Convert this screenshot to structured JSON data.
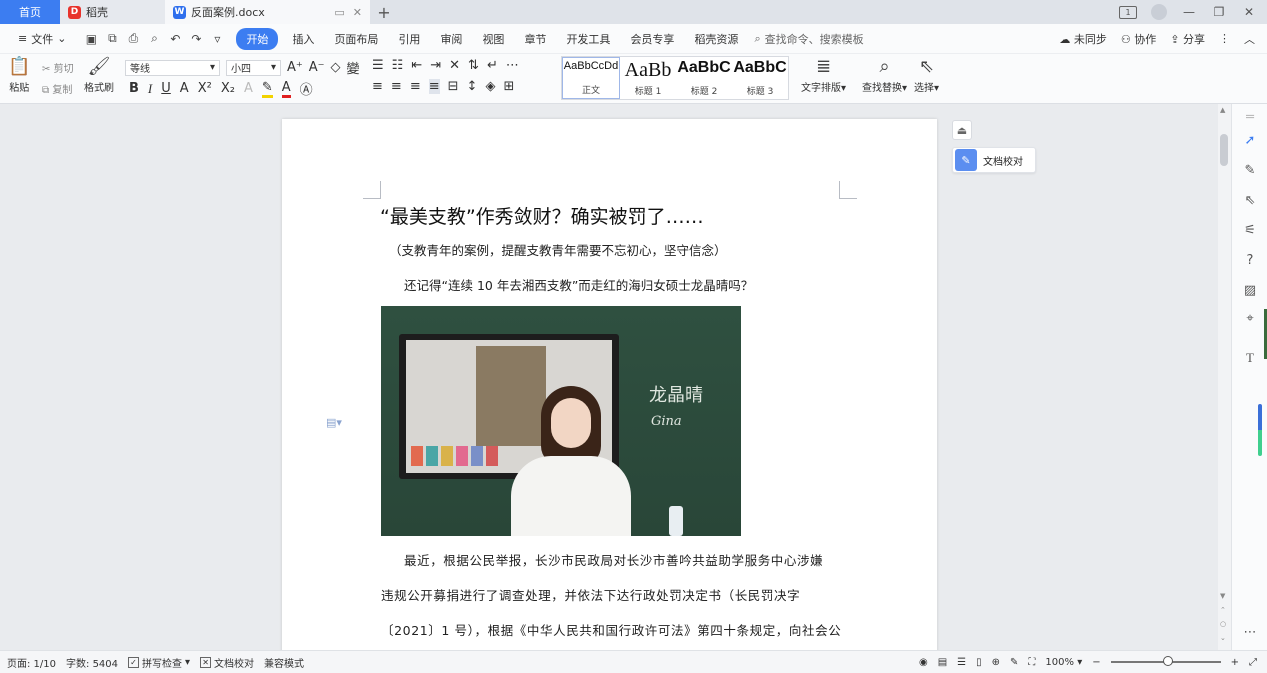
{
  "tabs": {
    "home": "首页",
    "daoke": "稻壳",
    "doc": "反面案例.docx",
    "new_tab": "+"
  },
  "window": {
    "badge": "1"
  },
  "menu": {
    "file": "文件",
    "items": [
      "开始",
      "插入",
      "页面布局",
      "引用",
      "审阅",
      "视图",
      "章节",
      "开发工具",
      "会员专享",
      "稻壳资源"
    ],
    "search": "查找命令、搜索模板",
    "sync": "未同步",
    "collab": "协作",
    "share": "分享"
  },
  "ribbon": {
    "paste": "粘贴",
    "cut": "剪切",
    "copy": "复制",
    "format_painter": "格式刷",
    "font": "等线",
    "size": "小四",
    "styles": [
      {
        "sample": "AaBbCcDd",
        "label": "正文"
      },
      {
        "sample": "AaBb",
        "label": "标题 1"
      },
      {
        "sample": "AaBbC",
        "label": "标题 2"
      },
      {
        "sample": "AaBbC",
        "label": "标题 3"
      }
    ],
    "text_layout": "文字排版",
    "find_replace": "查找替换",
    "select": "选择"
  },
  "document": {
    "title": "“最美支教”作秀敛财？确实被罚了……",
    "subtitle": "（支教青年的案例，提醒支教青年需要不忘初心，坚守信念）",
    "p1": "还记得“连续 10 年去湘西支教”而走红的海归女硕士龙晶晴吗？",
    "photo_writing": "龙晶晴",
    "photo_writing2": "Gina",
    "body_line1": "最近，根据公民举报，长沙市民政局对长沙市善吟共益助学服务中心涉嫌",
    "body_line2": "违规公开募捐进行了调查处理，并依法下达行政处罚决定书（长民罚决字",
    "body_line3": "〔2021〕1 号），根据《中华人民共和国行政许可法》第四十条规定，向社会公"
  },
  "panel": {
    "check": "文档校对"
  },
  "status": {
    "page": "页面: 1/10",
    "words": "字数: 5404",
    "spell": "拼写检查",
    "check": "文档校对",
    "compat": "兼容模式",
    "zoom": "100%"
  }
}
